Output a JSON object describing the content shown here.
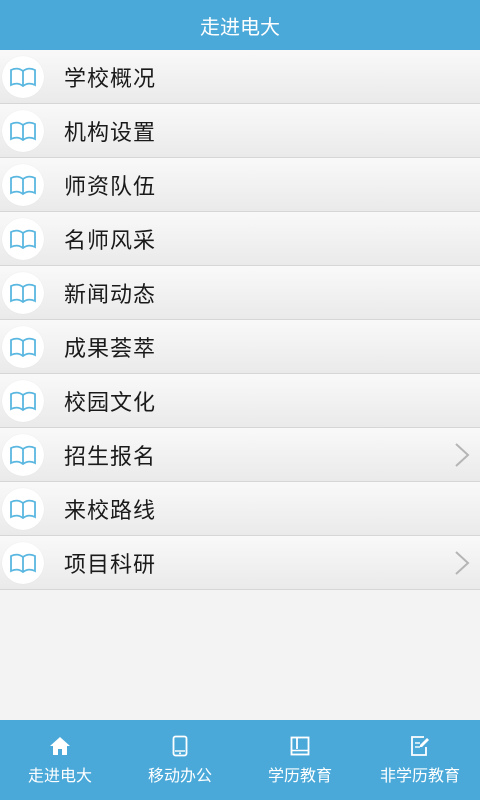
{
  "header": {
    "title": "走进电大"
  },
  "list": {
    "items": [
      {
        "label": "学校概况",
        "chevron": false
      },
      {
        "label": "机构设置",
        "chevron": false
      },
      {
        "label": "师资队伍",
        "chevron": false
      },
      {
        "label": "名师风采",
        "chevron": false
      },
      {
        "label": "新闻动态",
        "chevron": false
      },
      {
        "label": "成果荟萃",
        "chevron": false
      },
      {
        "label": "校园文化",
        "chevron": false
      },
      {
        "label": "招生报名",
        "chevron": true
      },
      {
        "label": "来校路线",
        "chevron": false
      },
      {
        "label": "项目科研",
        "chevron": true
      }
    ]
  },
  "tabbar": {
    "tabs": [
      {
        "label": "走进电大",
        "icon": "home-icon"
      },
      {
        "label": "移动办公",
        "icon": "phone-icon"
      },
      {
        "label": "学历教育",
        "icon": "book-icon"
      },
      {
        "label": "非学历教育",
        "icon": "edit-icon"
      }
    ]
  },
  "colors": {
    "accent": "#4aa9d9",
    "icon": "#5ab7e0"
  }
}
